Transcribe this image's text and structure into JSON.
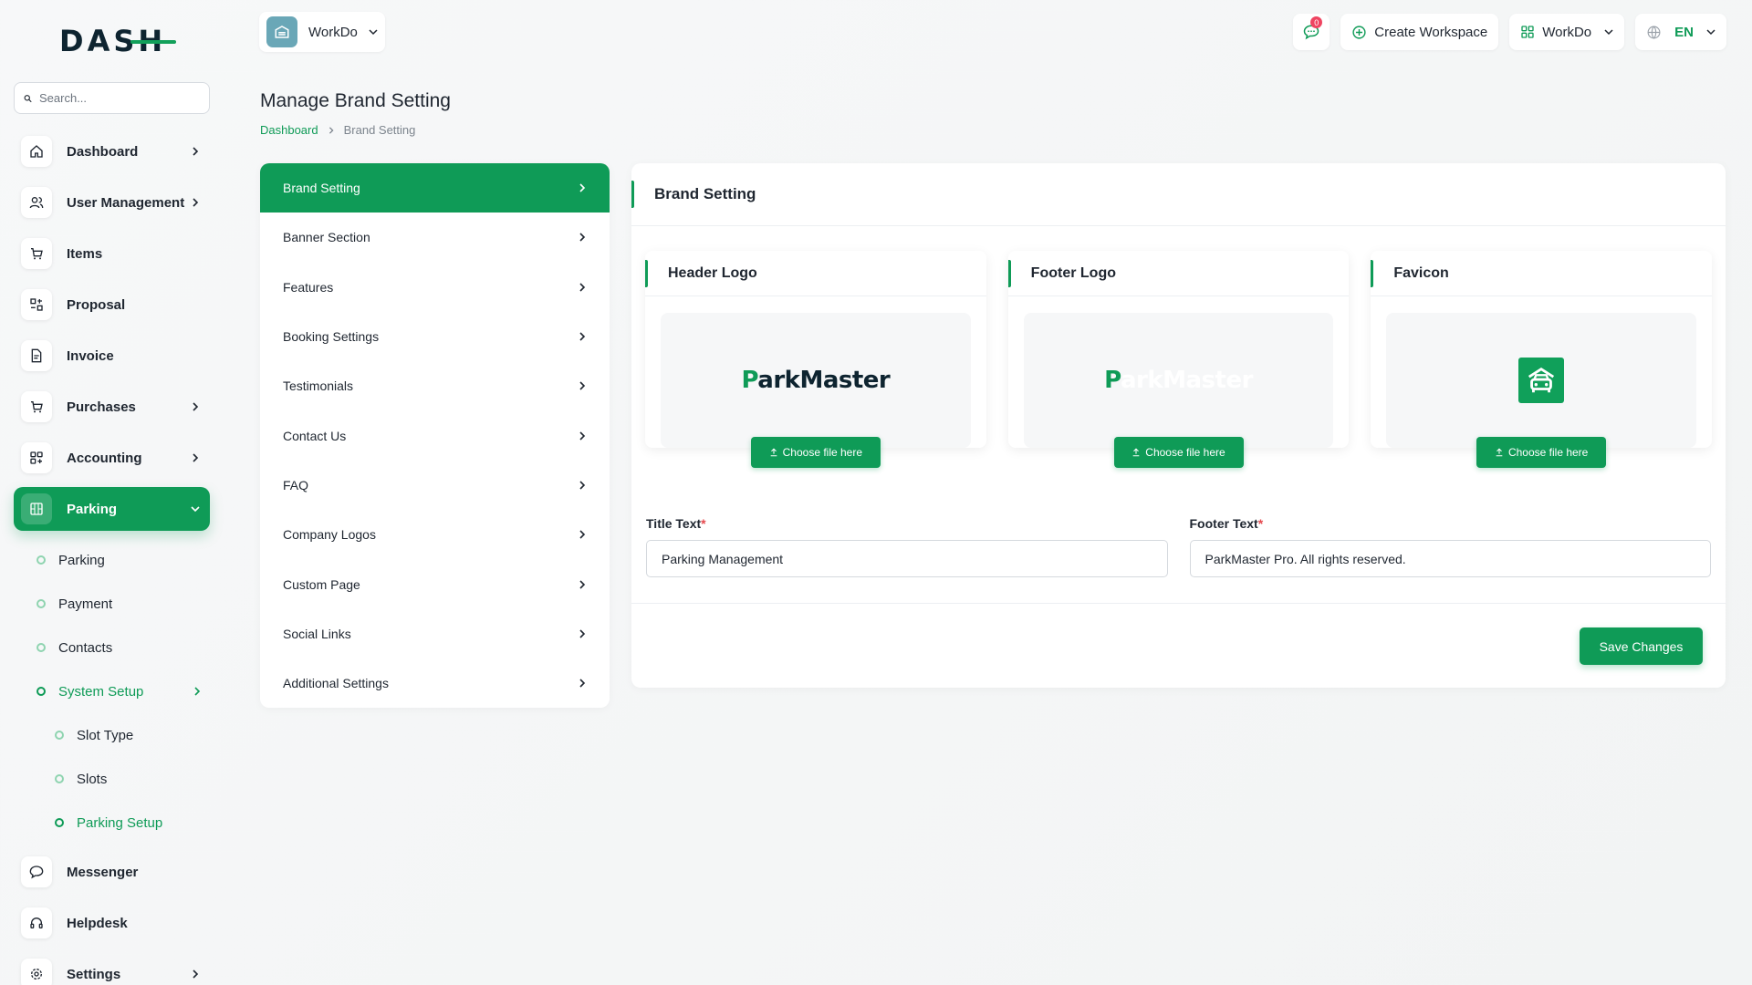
{
  "brand": {
    "logo_text": "DASH"
  },
  "search": {
    "placeholder": "Search..."
  },
  "sidebar": {
    "items": [
      {
        "label": "Dashboard",
        "icon": "home-icon",
        "chevron": true
      },
      {
        "label": "User Management",
        "icon": "users-icon",
        "chevron": true
      },
      {
        "label": "Items",
        "icon": "cart-icon",
        "chevron": false
      },
      {
        "label": "Proposal",
        "icon": "proposal-icon",
        "chevron": false
      },
      {
        "label": "Invoice",
        "icon": "file-icon",
        "chevron": false
      },
      {
        "label": "Purchases",
        "icon": "cart-icon",
        "chevron": true
      },
      {
        "label": "Accounting",
        "icon": "grid-icon",
        "chevron": true
      },
      {
        "label": "Parking",
        "icon": "parking-icon",
        "chevron": true,
        "active": true
      }
    ],
    "parking_sub": [
      "Parking",
      "Payment",
      "Contacts",
      "System Setup"
    ],
    "system_setup_sub": [
      "Slot Type",
      "Slots",
      "Parking Setup"
    ],
    "bottom_items": [
      {
        "label": "Messenger",
        "icon": "chat-icon"
      },
      {
        "label": "Helpdesk",
        "icon": "headset-icon"
      },
      {
        "label": "Settings",
        "icon": "gear-icon",
        "chevron": true
      }
    ]
  },
  "topbar": {
    "workspace": "WorkDo",
    "notification_count": "0",
    "create_workspace": "Create Workspace",
    "workspace_switch": "WorkDo",
    "language": "EN"
  },
  "page": {
    "title": "Manage Brand Setting",
    "breadcrumb": {
      "home": "Dashboard",
      "current": "Brand Setting"
    }
  },
  "settings_menu": [
    "Brand Setting",
    "Banner Section",
    "Features",
    "Booking Settings",
    "Testimonials",
    "Contact Us",
    "FAQ",
    "Company Logos",
    "Custom Page",
    "Social Links",
    "Additional Settings"
  ],
  "card": {
    "title": "Brand Setting",
    "header_logo": {
      "title": "Header Logo",
      "brand_p": "P",
      "brand_rest": "arkMaster",
      "button": "Choose file here"
    },
    "footer_logo": {
      "title": "Footer Logo",
      "brand_p": "P",
      "brand_rest": "arkMaster",
      "button": "Choose file here"
    },
    "favicon": {
      "title": "Favicon",
      "button": "Choose file here"
    },
    "title_text": {
      "label": "Title Text",
      "value": "Parking Management"
    },
    "footer_text": {
      "label": "Footer Text",
      "value": "ParkMaster Pro. All rights reserved."
    },
    "save_label": "Save Changes"
  },
  "colors": {
    "accent": "#0f9b57",
    "text": "#1f2630",
    "badge": "#ef4461"
  }
}
